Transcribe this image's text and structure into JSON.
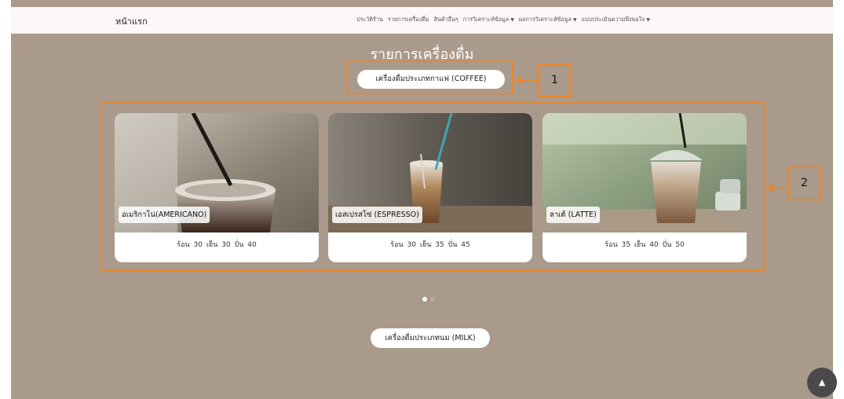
{
  "navbar": {
    "brand": "หน้าแรก",
    "links": [
      {
        "label": "ประวัติร้าน",
        "dropdown": false
      },
      {
        "label": "รายการเครื่องดื่ม",
        "dropdown": false
      },
      {
        "label": "สินค้าอื่นๆ",
        "dropdown": false
      },
      {
        "label": "การวิเคราะห์ข้อมูล",
        "dropdown": true
      },
      {
        "label": "ผลการวิเคราะห์ข้อมูล",
        "dropdown": true
      },
      {
        "label": "แบบประเมินความพึงพอใจ",
        "dropdown": true
      }
    ]
  },
  "page_title": "รายการเครื่องดื่ม",
  "category_coffee": "เครื่องดื่มประเภทกาแฟ (COFFEE)",
  "category_milk": "เครื่องดื่มประเภทนม (MILK)",
  "annotations": {
    "callout_1": "1",
    "callout_2": "2"
  },
  "cards": [
    {
      "name": "อเมริกาโน่(AMERICANO)",
      "prices": "ร้อน 30 เย็น 30 ปั่น 40"
    },
    {
      "name": "เอสเปรสโซ่ (ESPRESSO)",
      "prices": "ร้อน 30 เย็น 35 ปั่น 45"
    },
    {
      "name": "ลาเต้ (LATTE)",
      "prices": "ร้อน 35 เย็น 40 ปั่น 50"
    }
  ],
  "carousel": {
    "pages": 2,
    "active": 1
  },
  "colors": {
    "background": "#a99a8c",
    "annotation": "#e8862e",
    "navbar": "#fdf8f8"
  },
  "icons": {
    "scroll_top": "chevron-up-icon",
    "dropdown": "caret-down-icon"
  }
}
